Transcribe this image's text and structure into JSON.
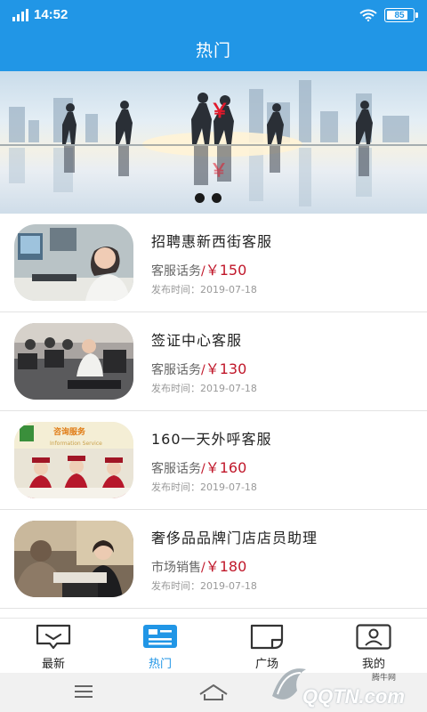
{
  "status_bar": {
    "time": "14:52",
    "battery": "85",
    "battery_level": 0.85
  },
  "header": {
    "title": "热门"
  },
  "banner": {
    "slide_count": 2
  },
  "jobs": [
    {
      "title": "招聘惠新西街客服",
      "category": "客服话务",
      "separator": "/",
      "price": "￥150",
      "date": "发布时间：2019-07-18"
    },
    {
      "title": "签证中心客服",
      "category": "客服话务",
      "separator": "/",
      "price": "￥130",
      "date": "发布时间：2019-07-18"
    },
    {
      "title": "160一天外呼客服",
      "category": "客服话务",
      "separator": "/",
      "price": "￥160",
      "date": "发布时间：2019-07-18"
    },
    {
      "title": "奢侈品品牌门店店员助理",
      "category": "市场销售",
      "separator": "/",
      "price": "￥180",
      "date": "发布时间：2019-07-18"
    }
  ],
  "thumb_texts": {
    "job3_sign": "咨询服务",
    "job3_sign_en": "Information Service"
  },
  "tabs": [
    {
      "label": "最新",
      "icon": "message-icon"
    },
    {
      "label": "热门",
      "icon": "news-icon"
    },
    {
      "label": "广场",
      "icon": "square-icon"
    },
    {
      "label": "我的",
      "icon": "profile-icon"
    }
  ],
  "active_tab": 1,
  "watermark": {
    "text": "QQTN.com",
    "sub": "腾牛网"
  },
  "colors": {
    "primary": "#2196e6",
    "price": "#c0172a"
  }
}
